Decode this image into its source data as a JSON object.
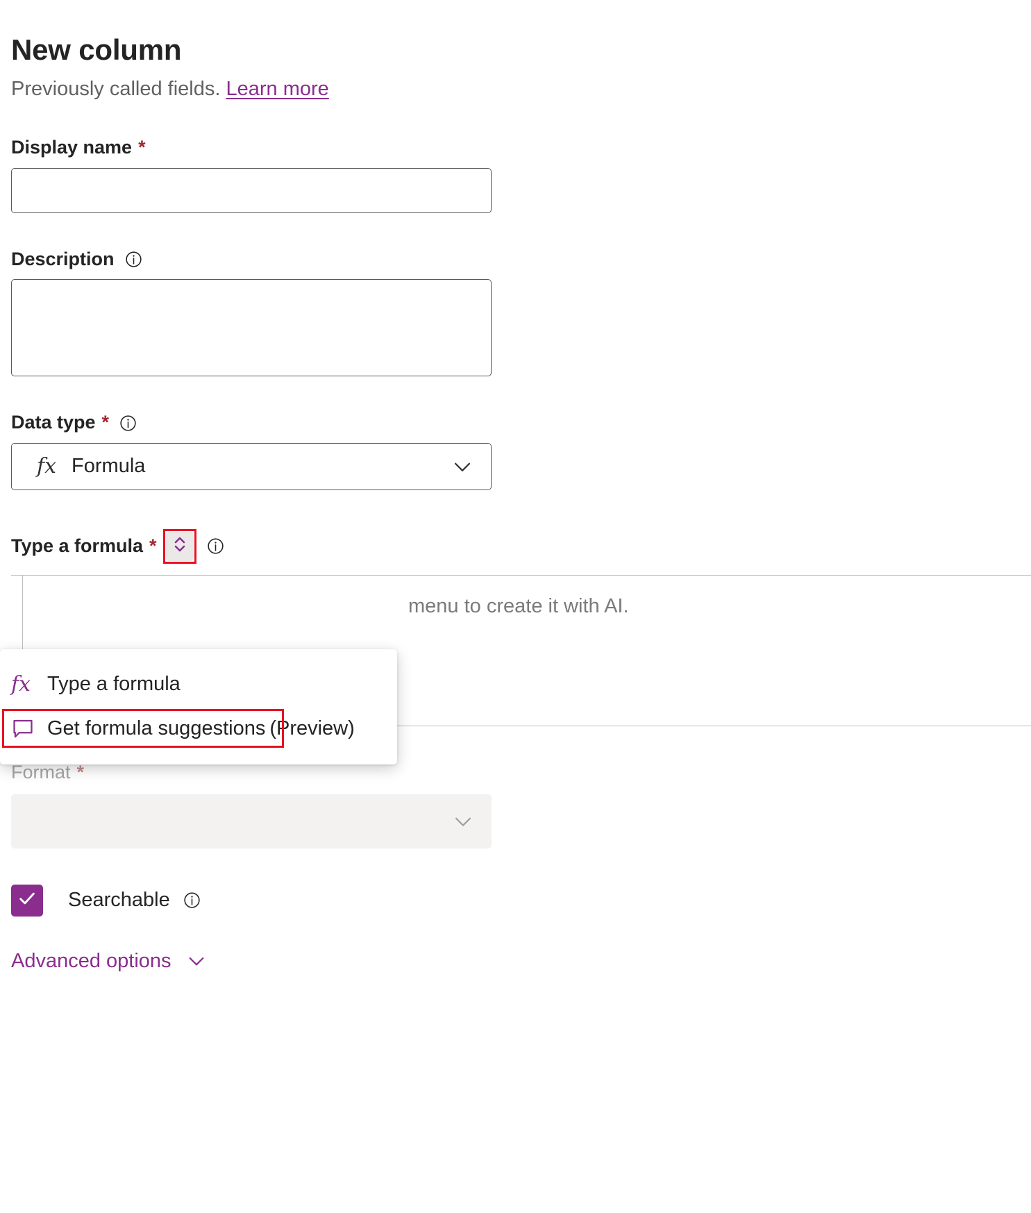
{
  "header": {
    "title": "New column",
    "subtitle_prefix": "Previously called fields.",
    "learn_more": "Learn more"
  },
  "fields": {
    "display_name": {
      "label": "Display name",
      "required_marker": "*",
      "value": "",
      "placeholder": ""
    },
    "description": {
      "label": "Description",
      "info_icon": "info-icon",
      "value": "",
      "placeholder": ""
    },
    "data_type": {
      "label": "Data type",
      "required_marker": "*",
      "info_icon": "info-icon",
      "selected_icon": "fx-icon",
      "selected_value": "Formula",
      "chevron_icon": "chevron-down-icon"
    },
    "type_a_formula": {
      "label": "Type a formula",
      "required_marker": "*",
      "spinner_icon": "chevron-up-down-icon",
      "info_icon": "info-icon",
      "placeholder": "menu to create it with AI."
    },
    "format": {
      "label": "Format",
      "required_marker": "*",
      "selected_value": "",
      "chevron_icon": "chevron-down-icon",
      "disabled": true
    },
    "searchable": {
      "label": "Searchable",
      "checked": true,
      "check_icon": "checkmark-icon",
      "info_icon": "info-icon"
    },
    "advanced_options": {
      "label": "Advanced options",
      "chevron_icon": "chevron-down-icon"
    }
  },
  "menu": {
    "items": [
      {
        "icon": "fx-icon",
        "label": "Type a formula",
        "suffix": ""
      },
      {
        "icon": "comment-icon",
        "label": "Get formula suggestions",
        "suffix": "(Preview)"
      }
    ]
  },
  "colors": {
    "accent_purple": "#8a2d8f",
    "required_red": "#a4262c",
    "highlight_red": "#e81123",
    "text_primary": "#242424",
    "text_secondary": "#616161",
    "disabled_bg": "#f3f2f1"
  }
}
